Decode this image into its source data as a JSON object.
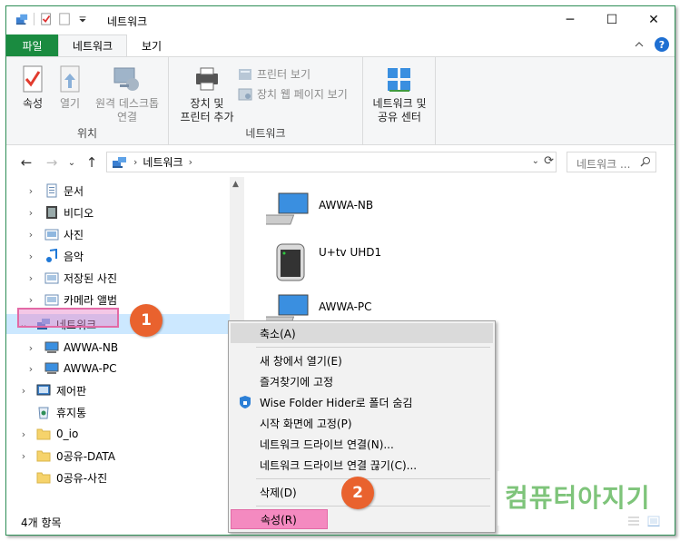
{
  "window": {
    "title": "네트워크",
    "minimize": "─",
    "maximize": "☐",
    "close": "✕"
  },
  "ribbon_tabs": {
    "file": "파일",
    "network": "네트워크",
    "view": "보기"
  },
  "ribbon": {
    "properties": "속성",
    "open": "열기",
    "remote_desktop": [
      "원격 데스크톱",
      "연결"
    ],
    "location_group": "위치",
    "add_device": [
      "장치 및",
      "프린터 추가"
    ],
    "view_printers": "프린터 보기",
    "view_device_webpage": "장치 웹 페이지 보기",
    "network_group": "네트워크",
    "network_sharing": [
      "네트워크 및",
      "공유 센터"
    ]
  },
  "address": {
    "path": "네트워크",
    "search_placeholder": "네트워크 ..."
  },
  "nav_tree": [
    {
      "label": "문서",
      "icon": "documents-icon"
    },
    {
      "label": "비디오",
      "icon": "videos-icon"
    },
    {
      "label": "사진",
      "icon": "pictures-icon"
    },
    {
      "label": "음악",
      "icon": "music-icon"
    },
    {
      "label": "저장된 사진",
      "icon": "saved-pictures-icon"
    },
    {
      "label": "카메라 앨범",
      "icon": "camera-roll-icon"
    },
    {
      "label": "네트워크",
      "icon": "network-icon"
    },
    {
      "label": "AWWA-NB",
      "icon": "computer-icon"
    },
    {
      "label": "AWWA-PC",
      "icon": "computer-icon"
    },
    {
      "label": "제어판",
      "icon": "control-panel-icon"
    },
    {
      "label": "휴지통",
      "icon": "recycle-bin-icon"
    },
    {
      "label": "0_io",
      "icon": "folder-icon"
    },
    {
      "label": "0공유-DATA",
      "icon": "folder-icon"
    },
    {
      "label": "0공유-사진",
      "icon": "folder-icon"
    }
  ],
  "content_items": [
    {
      "label": "AWWA-NB",
      "icon": "computer-icon"
    },
    {
      "label": "U+tv UHD1",
      "icon": "media-device-icon"
    },
    {
      "label": "AWWA-PC",
      "icon": "computer-icon"
    }
  ],
  "context_menu": {
    "collapse": "축소(A)",
    "open_new_window": "새 창에서 열기(E)",
    "pin_quick_access": "즐겨찾기에 고정",
    "wise_folder_hider": "Wise Folder Hider로 폴더 숨김",
    "pin_start": "시작 화면에 고정(P)",
    "map_drive": "네트워크 드라이브 연결(N)...",
    "disconnect_drive": "네트워크 드라이브 연결 끊기(C)...",
    "delete": "삭제(D)",
    "properties": "속성(R)"
  },
  "annotations": {
    "badge1": "1",
    "badge2": "2"
  },
  "status": {
    "item_count": "4개 항목"
  },
  "watermark": "컴퓨터아지기",
  "colors": {
    "file_tab": "#1a8b40",
    "selection": "#cce8ff",
    "highlight": "#f48ac0",
    "badge": "#e9622e"
  }
}
